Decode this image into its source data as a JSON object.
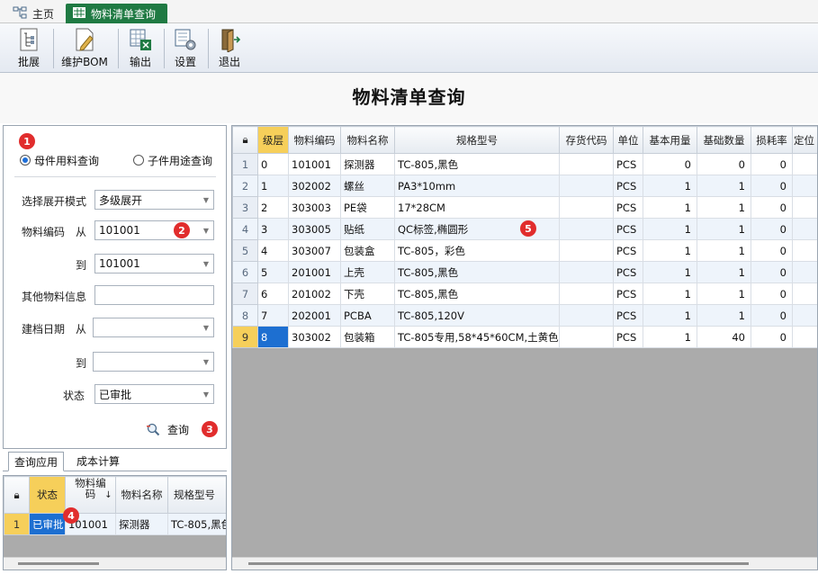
{
  "tabs": {
    "home": "主页",
    "active": "物料清单查询"
  },
  "toolbar": {
    "expand": "批展",
    "maintain_bom": "维护BOM",
    "export": "输出",
    "settings": "设置",
    "exit": "退出"
  },
  "page_title": "物料清单查询",
  "query": {
    "radio_parent": "母件用料查询",
    "radio_child": "子件用途查询",
    "expand_mode_label": "选择展开模式",
    "expand_mode_value": "多级展开",
    "code_label": "物料编码",
    "from_label": "从",
    "to_label": "到",
    "code_from": "101001",
    "code_to": "101001",
    "other_info_label": "其他物料信息",
    "other_info_value": "",
    "date_label": "建档日期",
    "date_from": "",
    "date_to": "",
    "status_label": "状态",
    "status_value": "已审批",
    "query_button": "查询"
  },
  "badges": [
    "1",
    "2",
    "3",
    "4",
    "5"
  ],
  "subtabs": {
    "apply": "查询应用",
    "cost": "成本计算"
  },
  "mini_grid": {
    "headers": [
      "状态",
      "物料编码",
      "物料名称",
      "规格型号"
    ],
    "header_code_line1": "物料编",
    "header_code_line2": "码",
    "sort_arrow": "↓",
    "rows": [
      {
        "no": "1",
        "status": "已审批",
        "code": "101001",
        "name": "探测器",
        "spec": "TC-805,黑色"
      }
    ]
  },
  "grid": {
    "headers": [
      "级层",
      "物料编码",
      "物料名称",
      "规格型号",
      "存货代码",
      "单位",
      "基本用量",
      "基础数量",
      "损耗率",
      "定位"
    ],
    "rows": [
      {
        "no": "1",
        "level": "0",
        "code": "101001",
        "name": "探测器",
        "spec": "TC-805,黑色",
        "stock": "",
        "unit": "PCS",
        "basic_qty": "0",
        "base_num": "0",
        "loss": "0"
      },
      {
        "no": "2",
        "level": "1",
        "code": "302002",
        "name": "螺丝",
        "spec": "PA3*10mm",
        "stock": "",
        "unit": "PCS",
        "basic_qty": "1",
        "base_num": "1",
        "loss": "0"
      },
      {
        "no": "3",
        "level": "2",
        "code": "303003",
        "name": "PE袋",
        "spec": "17*28CM",
        "stock": "",
        "unit": "PCS",
        "basic_qty": "1",
        "base_num": "1",
        "loss": "0"
      },
      {
        "no": "4",
        "level": "3",
        "code": "303005",
        "name": "贴纸",
        "spec": "QC标签,椭圆形",
        "stock": "",
        "unit": "PCS",
        "basic_qty": "1",
        "base_num": "1",
        "loss": "0"
      },
      {
        "no": "5",
        "level": "4",
        "code": "303007",
        "name": "包装盒",
        "spec": "TC-805，彩色",
        "stock": "",
        "unit": "PCS",
        "basic_qty": "1",
        "base_num": "1",
        "loss": "0"
      },
      {
        "no": "6",
        "level": "5",
        "code": "201001",
        "name": "上壳",
        "spec": "TC-805,黑色",
        "stock": "",
        "unit": "PCS",
        "basic_qty": "1",
        "base_num": "1",
        "loss": "0"
      },
      {
        "no": "7",
        "level": "6",
        "code": "201002",
        "name": "下壳",
        "spec": "TC-805,黑色",
        "stock": "",
        "unit": "PCS",
        "basic_qty": "1",
        "base_num": "1",
        "loss": "0"
      },
      {
        "no": "8",
        "level": "7",
        "code": "202001",
        "name": "PCBA",
        "spec": "TC-805,120V",
        "stock": "",
        "unit": "PCS",
        "basic_qty": "1",
        "base_num": "1",
        "loss": "0"
      },
      {
        "no": "9",
        "level": "8",
        "code": "303002",
        "name": "包装箱",
        "spec": "TC-805专用,58*45*60CM,土黄色",
        "stock": "",
        "unit": "PCS",
        "basic_qty": "1",
        "base_num": "40",
        "loss": "0"
      }
    ]
  },
  "colors": {
    "tab_active": "#1f7a43",
    "header_highlight": "#f6cf5a",
    "selection": "#1d6fd1",
    "badge": "#e12d2d"
  }
}
